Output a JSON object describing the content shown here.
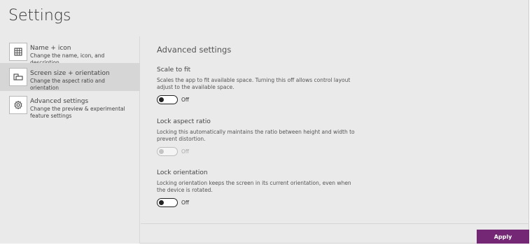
{
  "page": {
    "title": "Settings"
  },
  "sidebar": {
    "items": [
      {
        "title": "Name + icon",
        "description": "Change the name, icon, and description",
        "icon": "grid-icon",
        "selected": false
      },
      {
        "title": "Screen size + orientation",
        "description": "Change the aspect ratio and orientation",
        "icon": "screen-orientation-icon",
        "selected": true
      },
      {
        "title": "Advanced settings",
        "description": "Change the preview & experimental feature settings",
        "icon": "gear-icon",
        "selected": false
      }
    ]
  },
  "content": {
    "section_title": "Advanced settings",
    "settings": [
      {
        "label": "Scale to fit",
        "description": "Scales the app to fit available space. Turning this off allows control layout adjust to the available space.",
        "state": "Off",
        "enabled": true
      },
      {
        "label": "Lock aspect ratio",
        "description": "Locking this automatically maintains the ratio between height and width to prevent distortion.",
        "state": "Off",
        "enabled": false
      },
      {
        "label": "Lock orientation",
        "description": "Locking orientation keeps the screen in its current orientation, even when the device is rotated.",
        "state": "Off",
        "enabled": true
      }
    ]
  },
  "footer": {
    "apply_label": "Apply"
  },
  "colors": {
    "accent": "#742774",
    "background": "#eaeaea",
    "selected": "#d6d6d6"
  }
}
